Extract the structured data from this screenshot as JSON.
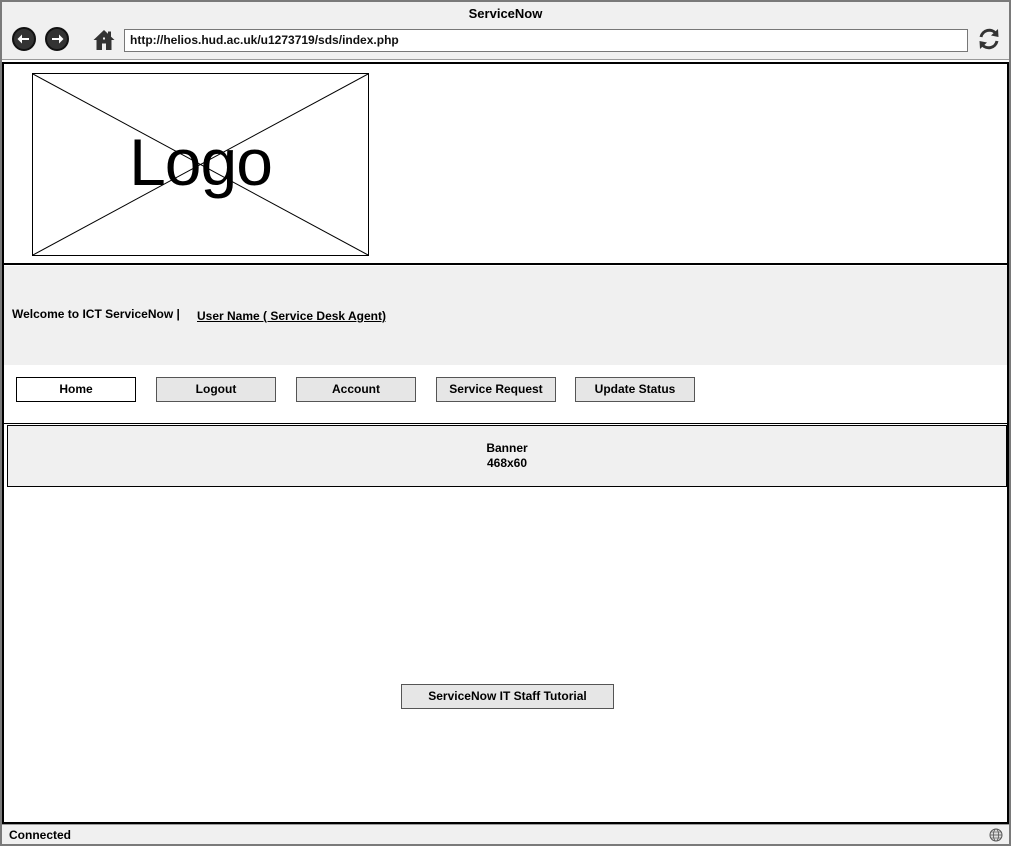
{
  "window": {
    "title": "ServiceNow"
  },
  "toolbar": {
    "url": "http://helios.hud.ac.uk/u1273719/sds/index.php",
    "icons": [
      "arrow-left-icon",
      "arrow-right-icon",
      "home-icon",
      "refresh-icon"
    ]
  },
  "header": {
    "logo_text": "Logo"
  },
  "welcome": {
    "text": "Welcome to ICT ServiceNow |",
    "user_link": "User Name ( Service Desk Agent)"
  },
  "menu": {
    "items": [
      {
        "label": "Home",
        "active": true
      },
      {
        "label": "Logout",
        "active": false
      },
      {
        "label": "Account",
        "active": false
      },
      {
        "label": "Service Request",
        "active": false
      },
      {
        "label": "Update Status",
        "active": false
      }
    ]
  },
  "banner": {
    "line1": "Banner",
    "line2": "468x60"
  },
  "main": {
    "tutorial_button": "ServiceNow IT Staff Tutorial"
  },
  "status": {
    "text": "Connected",
    "icon": "globe-icon"
  },
  "colors": {
    "chrome": "#f0f0f0",
    "button": "#e6e6e6",
    "border": "#000000"
  }
}
